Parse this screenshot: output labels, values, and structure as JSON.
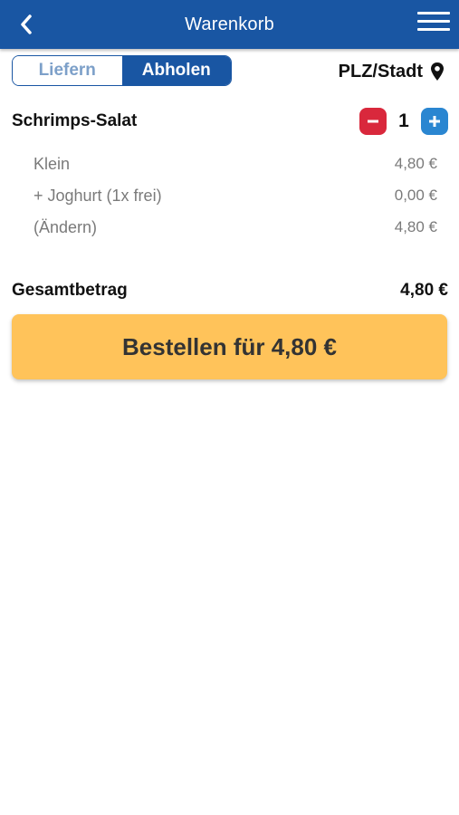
{
  "header": {
    "title": "Warenkorb",
    "back_icon": "chevron-left-icon",
    "menu_icon": "hamburger-menu-icon"
  },
  "mode_toggle": {
    "options": [
      "Liefern",
      "Abholen"
    ],
    "selected": "Abholen"
  },
  "location": {
    "label": "PLZ/Stadt",
    "icon": "map-pin-icon"
  },
  "cart": {
    "item": {
      "name": "Schrimps-Salat",
      "quantity": "1",
      "details": [
        {
          "label": "Klein",
          "price": "4,80 €"
        },
        {
          "label": "+ Joghurt (1x frei)",
          "price": "0,00 €"
        },
        {
          "label": "(Ändern)",
          "price": "4,80 €"
        }
      ]
    },
    "total_label": "Gesamtbetrag",
    "total_value": "4,80 €"
  },
  "order_button": {
    "label": "Bestellen für 4,80 €"
  },
  "colors": {
    "brand": "#1956a3",
    "accent": "#ffc35a",
    "minus": "#d9283c",
    "plus": "#2a86d1"
  }
}
